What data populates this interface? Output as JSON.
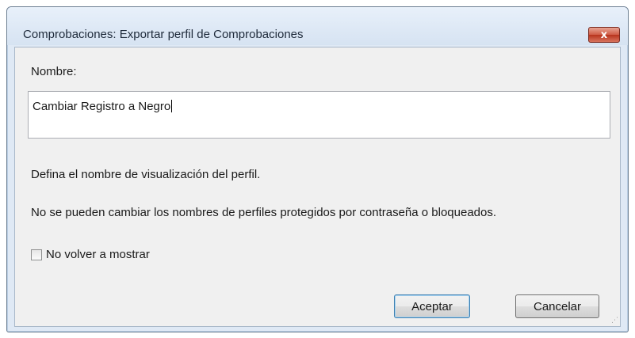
{
  "window": {
    "title": "Comprobaciones: Exportar perfil de Comprobaciones",
    "close_glyph": "x"
  },
  "form": {
    "name_label": "Nombre:",
    "name_value": "Cambiar Registro a Negro",
    "description_1": "Defina el nombre de visualización del perfil.",
    "description_2": "No se pueden cambiar los nombres de perfiles protegidos por contraseña o bloqueados.",
    "checkbox_label": "No volver a mostrar",
    "checkbox_checked": false
  },
  "buttons": {
    "ok_label": "Aceptar",
    "cancel_label": "Cancelar"
  },
  "icons": {
    "close": "close-icon",
    "resize": "resize-grip-icon"
  },
  "colors": {
    "close_button": "#c8452e",
    "frame": "#dfe9f5",
    "client": "#f0f0f0"
  }
}
